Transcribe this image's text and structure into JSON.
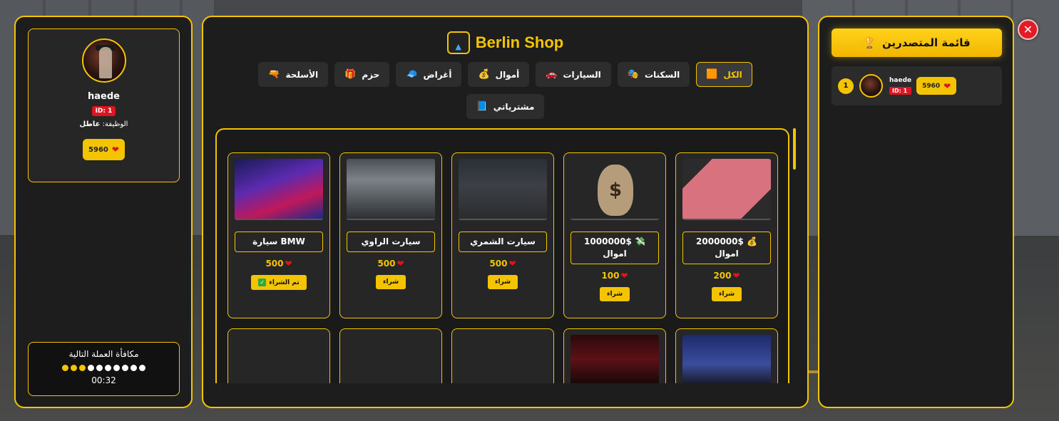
{
  "colors": {
    "accent": "#f5c400",
    "panel_bg": "#1d1d1d",
    "danger": "#e0141e"
  },
  "profile": {
    "name": "haede",
    "id_label": "ID: 1",
    "job_label": "الوظيفة:",
    "job_value": "عاطل",
    "coins": "5960",
    "coin_icon": "heart-coin-icon"
  },
  "reward": {
    "title": "مكافأة العملة التالية",
    "dots_filled": 3,
    "dots_total": 10,
    "time": "00:32"
  },
  "shop": {
    "title": "Berlin Shop",
    "logo_icon": "house-icon",
    "tabs": [
      {
        "label": "الكل",
        "icon": "🟧",
        "active": true
      },
      {
        "label": "السكنات",
        "icon": "🎭",
        "active": false
      },
      {
        "label": "السيارات",
        "icon": "🚗",
        "active": false
      },
      {
        "label": "أموال",
        "icon": "💰",
        "active": false
      },
      {
        "label": "أغراض",
        "icon": "🧢",
        "active": false
      },
      {
        "label": "حزم",
        "icon": "🎁",
        "active": false
      },
      {
        "label": "الأسلحة",
        "icon": "🔫",
        "active": false
      },
      {
        "label": "مشترياتي",
        "icon": "📘",
        "active": false
      }
    ],
    "items": [
      {
        "name": "2000000$",
        "name_icon": "💰",
        "subtitle": "اموال",
        "price": "200",
        "button": "شراء",
        "bought": false,
        "image": "pink-cash-stack"
      },
      {
        "name": "1000000$",
        "name_icon": "💸",
        "subtitle": "اموال",
        "price": "100",
        "button": "شراء",
        "bought": false,
        "image": "money-bag"
      },
      {
        "name": "سيارت الشمري",
        "name_icon": "",
        "subtitle": "",
        "price": "500",
        "button": "شراء",
        "bought": false,
        "image": "dark-road"
      },
      {
        "name": "سيارت الراوي",
        "name_icon": "",
        "subtitle": "",
        "price": "500",
        "button": "شراء",
        "bought": false,
        "image": "grey-road-car"
      },
      {
        "name": "BMW سيارة",
        "name_icon": "",
        "subtitle": "",
        "price": "500",
        "button": "تم الشراء",
        "bought": true,
        "image": "neon-car"
      }
    ],
    "partial_items": [
      "batman-skin",
      "catwoman-skin",
      "money-roll",
      "cash-bundle",
      "cash-stacks"
    ]
  },
  "leaderboard": {
    "title": "قائمة المتصدرين",
    "title_icon": "trophy-icon",
    "entries": [
      {
        "rank": "1",
        "name": "haede",
        "id_label": "ID: 1",
        "coins": "5960"
      }
    ]
  },
  "close_label": "✕"
}
